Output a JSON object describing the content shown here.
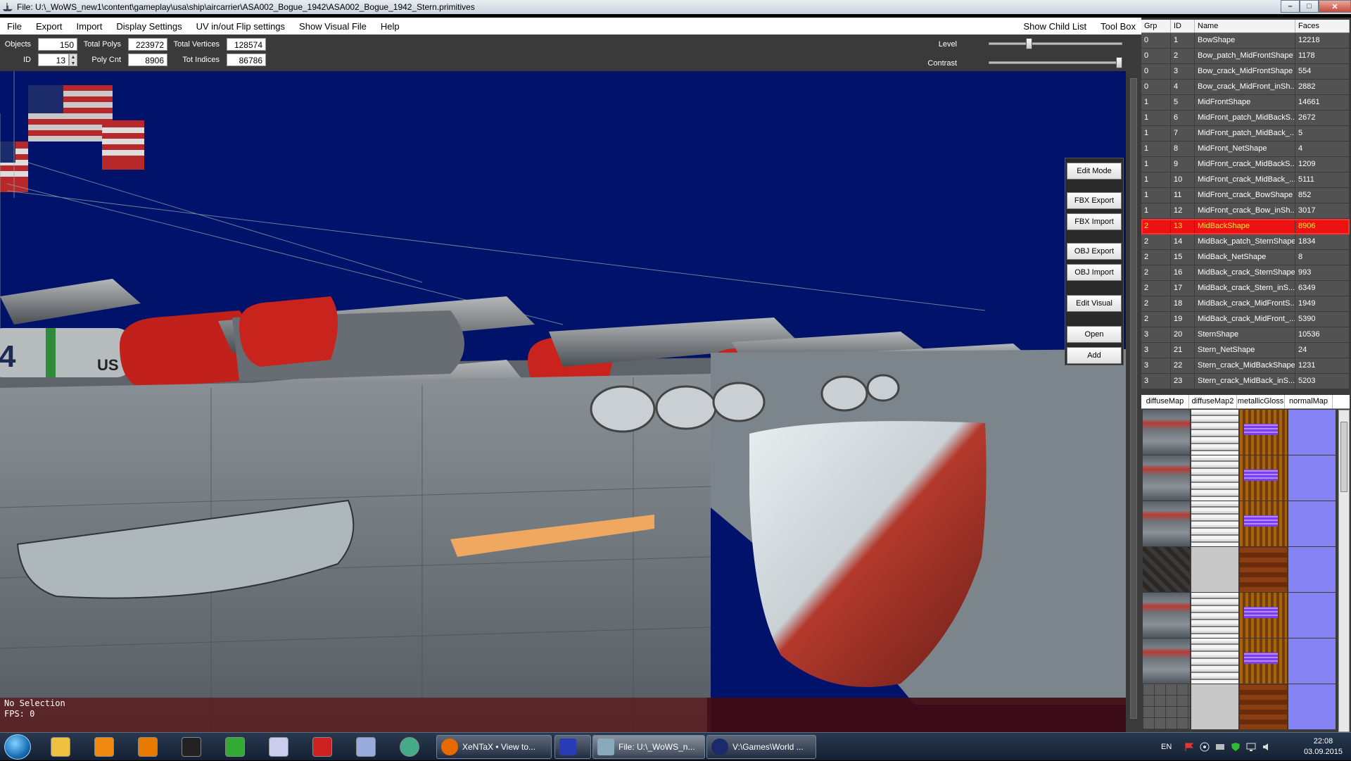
{
  "window": {
    "title": "File: U:\\_WoWS_new1\\content\\gameplay\\usa\\ship\\aircarrier\\ASA002_Bogue_1942\\ASA002_Bogue_1942_Stern.primitives",
    "minimize": "0",
    "maximize": "1",
    "close": "r"
  },
  "menu": {
    "items": [
      "File",
      "Export",
      "Import",
      "Display Settings",
      "UV in/out Flip settings",
      "Show Visual File",
      "Help"
    ],
    "right_items": [
      "Show Child List",
      "Tool Box"
    ]
  },
  "stats": {
    "objects_label": "Objects",
    "objects": "150",
    "id_label": "ID",
    "id": "13",
    "total_polys_label": "Total Polys",
    "total_polys": "223972",
    "poly_cnt_label": "Poly Cnt",
    "poly_cnt": "8906",
    "total_vertices_label": "Total Vertices",
    "total_vertices": "128574",
    "tot_indices_label": "Tot Indices",
    "tot_indices": "86786",
    "level_label": "Level",
    "level": 0.3,
    "contrast_label": "Contrast",
    "contrast": 1.0
  },
  "toolbox": {
    "buttons": [
      "Edit Mode",
      "FBX Export",
      "FBX Import",
      "OBJ Export",
      "OBJ Import",
      "Edit Visual",
      "Open",
      "Add"
    ]
  },
  "viewport": {
    "status_line1": "No Selection",
    "status_line2": "FPS: 0",
    "hull_text": "US NAVY",
    "hull_number": "4",
    "colors": {
      "background": "#00126a",
      "hull": "#6e7479",
      "rudder": "#b3392c"
    }
  },
  "grid": {
    "headers": [
      "Grp",
      "ID",
      "Name",
      "Faces"
    ],
    "selected_id": "13",
    "rows": [
      {
        "grp": "0",
        "id": "1",
        "name": "BowShape",
        "faces": "12218"
      },
      {
        "grp": "0",
        "id": "2",
        "name": "Bow_patch_MidFrontShape",
        "faces": "1178"
      },
      {
        "grp": "0",
        "id": "3",
        "name": "Bow_crack_MidFrontShape",
        "faces": "554"
      },
      {
        "grp": "0",
        "id": "4",
        "name": "Bow_crack_MidFront_inSh...",
        "faces": "2882"
      },
      {
        "grp": "1",
        "id": "5",
        "name": "MidFrontShape",
        "faces": "14661"
      },
      {
        "grp": "1",
        "id": "6",
        "name": "MidFront_patch_MidBackS...",
        "faces": "2672"
      },
      {
        "grp": "1",
        "id": "7",
        "name": "MidFront_patch_MidBack_...",
        "faces": "5"
      },
      {
        "grp": "1",
        "id": "8",
        "name": "MidFront_NetShape",
        "faces": "4"
      },
      {
        "grp": "1",
        "id": "9",
        "name": "MidFront_crack_MidBackS...",
        "faces": "1209"
      },
      {
        "grp": "1",
        "id": "10",
        "name": "MidFront_crack_MidBack_...",
        "faces": "5111"
      },
      {
        "grp": "1",
        "id": "11",
        "name": "MidFront_crack_BowShape",
        "faces": "852"
      },
      {
        "grp": "1",
        "id": "12",
        "name": "MidFront_crack_Bow_inSh...",
        "faces": "3017"
      },
      {
        "grp": "2",
        "id": "13",
        "name": "MidBackShape",
        "faces": "8906"
      },
      {
        "grp": "2",
        "id": "14",
        "name": "MidBack_patch_SternShape",
        "faces": "1834"
      },
      {
        "grp": "2",
        "id": "15",
        "name": "MidBack_NetShape",
        "faces": "8"
      },
      {
        "grp": "2",
        "id": "16",
        "name": "MidBack_crack_SternShape",
        "faces": "993"
      },
      {
        "grp": "2",
        "id": "17",
        "name": "MidBack_crack_Stern_inS...",
        "faces": "6349"
      },
      {
        "grp": "2",
        "id": "18",
        "name": "MidBack_crack_MidFrontS...",
        "faces": "1949"
      },
      {
        "grp": "2",
        "id": "19",
        "name": "MidBack_crack_MidFront_...",
        "faces": "5390"
      },
      {
        "grp": "3",
        "id": "20",
        "name": "SternShape",
        "faces": "10536"
      },
      {
        "grp": "3",
        "id": "21",
        "name": "Stern_NetShape",
        "faces": "24"
      },
      {
        "grp": "3",
        "id": "22",
        "name": "Stern_crack_MidBackShape",
        "faces": "1231"
      },
      {
        "grp": "3",
        "id": "23",
        "name": "Stern_crack_MidBack_inS...",
        "faces": "5203"
      }
    ]
  },
  "textures": {
    "headers": [
      "diffuseMap",
      "diffuseMap2",
      "metallicGloss",
      "normalMap"
    ],
    "rows": [
      [
        "diffuse",
        "diffuse2",
        "metal",
        "normal"
      ],
      [
        "diffuse",
        "diffuse2",
        "metal",
        "normal"
      ],
      [
        "diffuse",
        "diffuse2",
        "metal",
        "normal"
      ],
      [
        "diffuse dark",
        "diffuse2 blank",
        "metal rusty",
        "normal"
      ],
      [
        "diffuse",
        "diffuse2",
        "metal",
        "normal"
      ],
      [
        "diffuse",
        "diffuse2",
        "metal",
        "normal"
      ],
      [
        "diffuse grid",
        "diffuse2 blank",
        "metal rusty",
        "normal"
      ]
    ]
  },
  "taskbar": {
    "pinned": [
      "explorer-icon",
      "vlc-icon",
      "vlc-alt-icon",
      "terminal-icon",
      "tool-icon",
      "calculator-icon",
      "pdf-icon",
      "notes-icon",
      "chrome-icon"
    ],
    "tasks": [
      {
        "label": "XeNTaX • View to...",
        "icon": "firefox-icon"
      },
      {
        "label": "",
        "icon": "save-disk-icon"
      },
      {
        "label": "File: U:\\_WoWS_n...",
        "icon": "ship-icon"
      },
      {
        "label": "V:\\Games\\World ...",
        "icon": "unreal-icon"
      }
    ],
    "language": "EN",
    "time": "22:08",
    "date": "03.09.2015"
  }
}
